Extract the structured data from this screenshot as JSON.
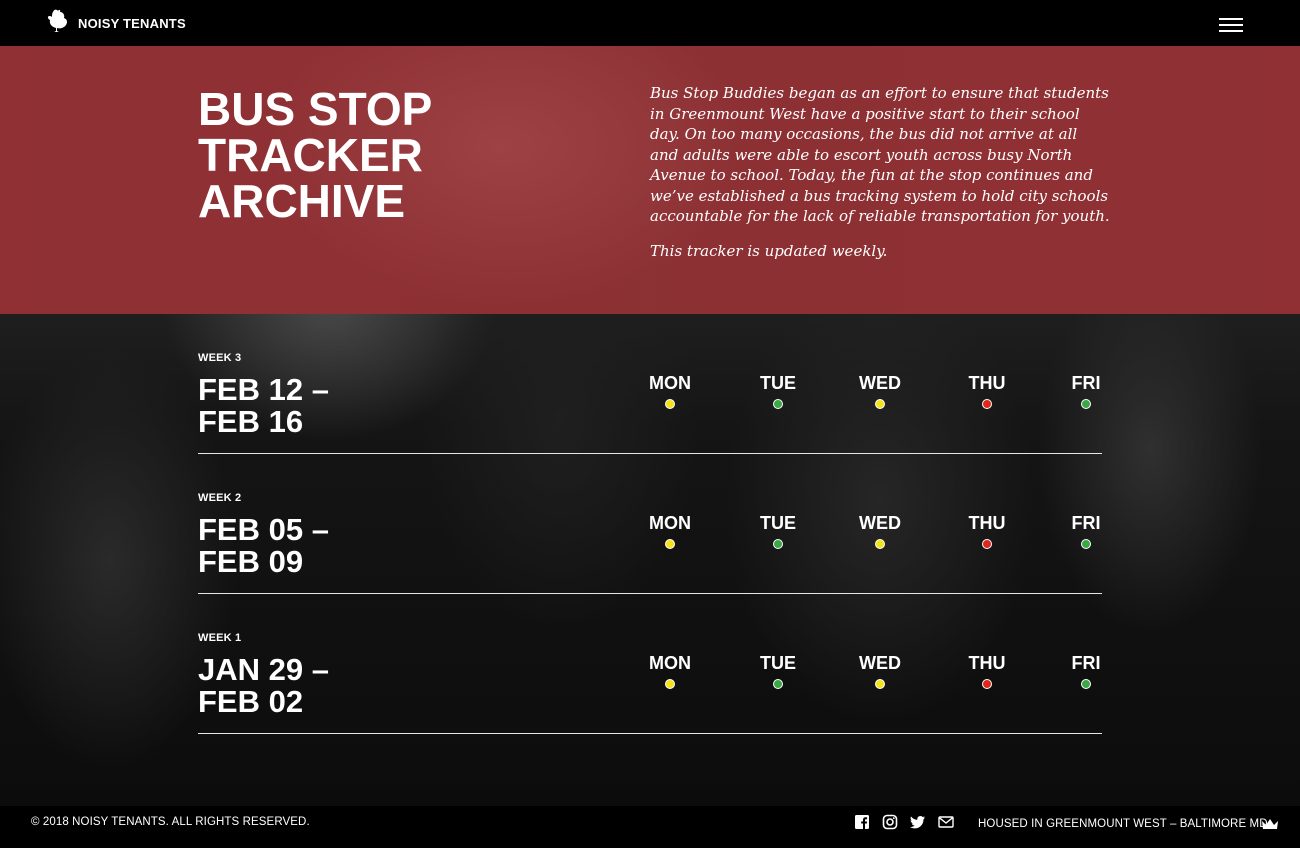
{
  "header": {
    "brand": "NOISY TENANTS",
    "logo_icon": "rooster-icon",
    "menu_icon": "hamburger-menu-icon"
  },
  "hero": {
    "title_lines": [
      "BUS STOP",
      "TRACKER",
      "ARCHIVE"
    ],
    "description": "Bus Stop Buddies began as an effort to ensure that students in Greenmount West have a positive start to their school day. On too many occasions, the bus did not arrive at all and adults were able to escort youth across busy North Avenue to school. Today, the fun at the stop continues and we’ve established a bus tracking system to hold city schools accountable for the lack of reliable transportation for youth.",
    "note": "This tracker is updated weekly.",
    "background_color": "#962e32"
  },
  "status_colors": {
    "yellow": "#f5e21b",
    "green": "#3aa845",
    "red": "#e0261b"
  },
  "weeks": [
    {
      "label": "WEEK 3",
      "dates_line1": "FEB 12 –",
      "dates_line2": "FEB 16",
      "days": [
        {
          "name": "MON",
          "status": "yellow"
        },
        {
          "name": "TUE",
          "status": "green"
        },
        {
          "name": "WED",
          "status": "yellow"
        },
        {
          "name": "THU",
          "status": "red"
        },
        {
          "name": "FRI",
          "status": "green"
        }
      ]
    },
    {
      "label": "WEEK 2",
      "dates_line1": "FEB 05 –",
      "dates_line2": "FEB 09",
      "days": [
        {
          "name": "MON",
          "status": "yellow"
        },
        {
          "name": "TUE",
          "status": "green"
        },
        {
          "name": "WED",
          "status": "yellow"
        },
        {
          "name": "THU",
          "status": "red"
        },
        {
          "name": "FRI",
          "status": "green"
        }
      ]
    },
    {
      "label": "WEEK 1",
      "dates_line1": "JAN 29 –",
      "dates_line2": "FEB 02",
      "days": [
        {
          "name": "MON",
          "status": "yellow"
        },
        {
          "name": "TUE",
          "status": "green"
        },
        {
          "name": "WED",
          "status": "yellow"
        },
        {
          "name": "THU",
          "status": "red"
        },
        {
          "name": "FRI",
          "status": "green"
        }
      ]
    }
  ],
  "footer": {
    "copyright": "© 2018 NOISY TENANTS. ALL RIGHTS RESERVED.",
    "social_icons": [
      "facebook-icon",
      "instagram-icon",
      "twitter-icon",
      "email-icon"
    ],
    "location": "HOUSED IN GREENMOUNT WEST – BALTIMORE MD",
    "location_icon": "crown-icon"
  }
}
